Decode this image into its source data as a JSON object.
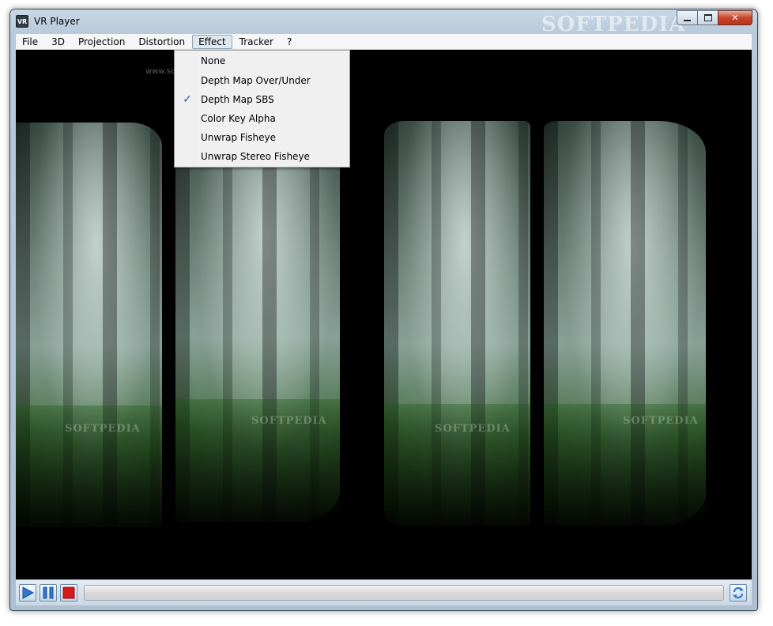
{
  "window": {
    "title": "VR Player",
    "app_icon_label": "VR",
    "title_watermark": "SOFTPEDIA",
    "caption": {
      "minimize": "▁",
      "maximize": "▢",
      "close": "✕"
    }
  },
  "menubar": {
    "items": [
      {
        "label": "File"
      },
      {
        "label": "3D"
      },
      {
        "label": "Projection"
      },
      {
        "label": "Distortion"
      },
      {
        "label": "Effect",
        "open": true
      },
      {
        "label": "Tracker"
      },
      {
        "label": "?"
      }
    ]
  },
  "effect_menu": {
    "items": [
      {
        "label": "None",
        "checked": false
      },
      {
        "label": "Depth Map Over/Under",
        "checked": false
      },
      {
        "label": "Depth Map SBS",
        "checked": true
      },
      {
        "label": "Color Key Alpha",
        "checked": false
      },
      {
        "label": "Unwrap Fisheye",
        "checked": false
      },
      {
        "label": "Unwrap Stereo Fisheye",
        "checked": false
      }
    ],
    "check_glyph": "✓"
  },
  "viewport": {
    "watermark_sub": "www.softpedia.com",
    "panel_watermark": "SOFTPEDIA"
  },
  "controls": {
    "play_icon": "play-icon",
    "pause_icon": "pause-icon",
    "stop_icon": "stop-icon",
    "refresh_icon": "refresh-icon",
    "seek_progress": 0
  },
  "colors": {
    "accent_blue": "#2f78d0",
    "stop_red": "#d41a1a",
    "check_blue": "#1c5fb4"
  }
}
